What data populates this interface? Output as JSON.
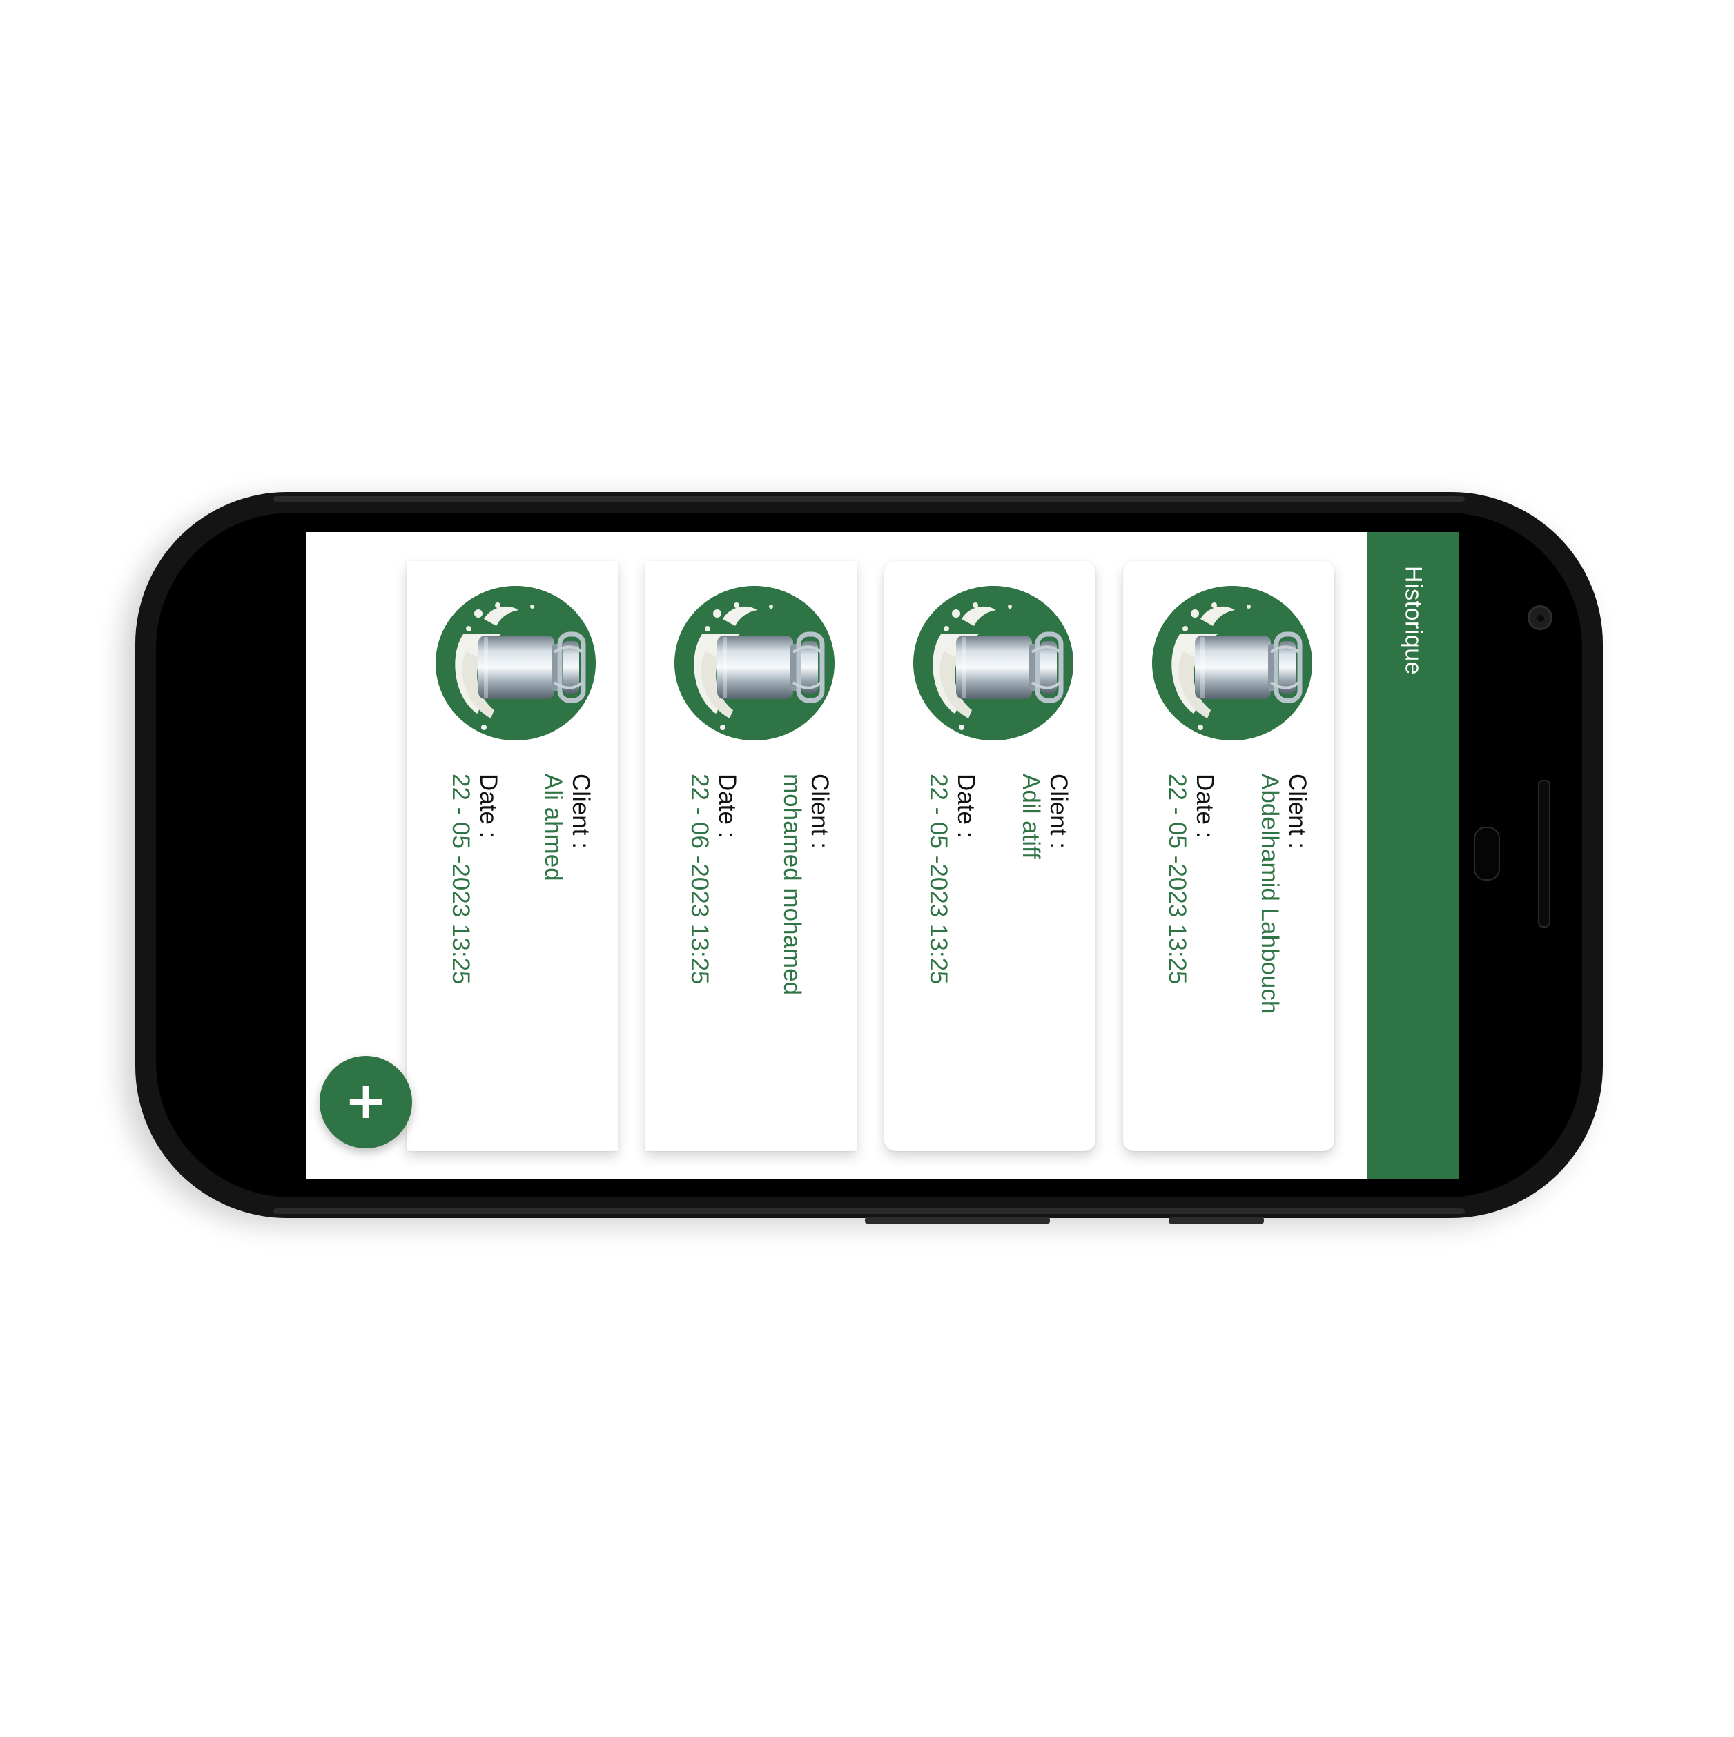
{
  "app_bar": {
    "title": "Historique",
    "color": "#2e7444"
  },
  "cards": [
    {
      "client_label": "Client :",
      "client_name": "Abdelhamid Lahbouch",
      "date_label": "Date :",
      "date_value": "22 - 05 -2023 13:25",
      "image_icon": "milk-can-icon"
    },
    {
      "client_label": "Client :",
      "client_name": "Adil atiff",
      "date_label": "Date :",
      "date_value": "22 - 05 -2023 13:25",
      "image_icon": "milk-can-icon"
    },
    {
      "client_label": "Client :",
      "client_name": "mohamed mohamed",
      "date_label": "Date :",
      "date_value": "22 - 06 -2023 13:25",
      "image_icon": "milk-can-icon"
    },
    {
      "client_label": "Client :",
      "client_name": "Ali ahmed",
      "date_label": "Date :",
      "date_value": "22 - 05 -2023 13:25",
      "image_icon": "milk-can-icon"
    }
  ],
  "fab": {
    "label": "+",
    "icon": "plus-icon"
  },
  "colors": {
    "accent": "#2e7444",
    "text": "#111111",
    "background": "#ffffff",
    "device": "#141414"
  }
}
